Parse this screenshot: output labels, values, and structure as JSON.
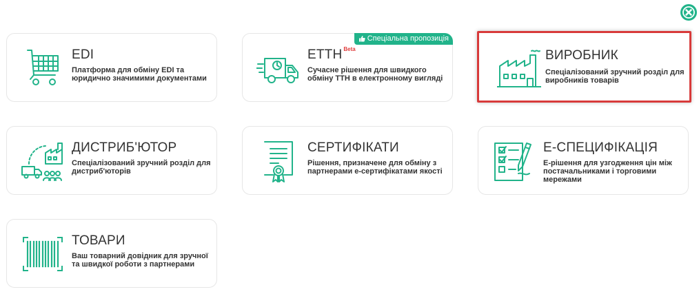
{
  "colors": {
    "accent": "#21b38a",
    "selected_border": "#d83a3a"
  },
  "close": {
    "icon": "close-circle-icon"
  },
  "cards": [
    {
      "title": "EDI",
      "desc": "Платформа для обміну EDI та юридично значимими документами",
      "icon": "shopping-cart-icon"
    },
    {
      "title": "ЕТТН",
      "beta": "Beta",
      "badge": "Спеціальна пропозиція",
      "desc": "Сучасне рішення для швидкого обміну ТТН в електронному вигляді",
      "icon": "delivery-truck-icon"
    },
    {
      "title": "ВИРОБНИК",
      "desc": "Спеціалізований зручний розділ для виробників товарів",
      "icon": "factory-icon",
      "selected": true
    },
    {
      "title": "ДИСТРИБ'ЮТОР",
      "desc": "Спеціалізований зручний розділ для дистриб'юторів",
      "icon": "distributor-icon"
    },
    {
      "title": "СЕРТИФІКАТИ",
      "desc": "Рішення, призначене для обміну з партнерами е-сертифікатами якості",
      "icon": "certificate-icon"
    },
    {
      "title": "Е-СПЕЦИФІКАЦІЯ",
      "desc": "Е-рішення для узгодження цін між постачальниками і торговими мережами",
      "icon": "checklist-icon"
    },
    {
      "title": "ТОВАРИ",
      "desc": "Ваш товарний довідник для зручної та швидкої роботи з партнерами",
      "icon": "barcode-icon"
    }
  ]
}
